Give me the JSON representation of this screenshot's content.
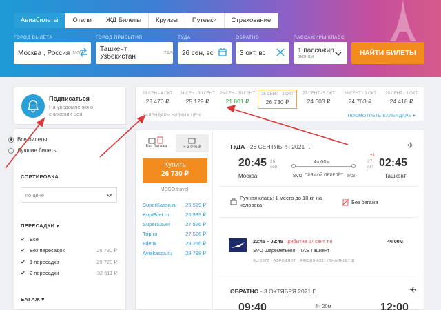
{
  "tabs": [
    "Авиабилеты",
    "Отели",
    "ЖД Билеты",
    "Круизы",
    "Путевки",
    "Страхование"
  ],
  "search": {
    "from_label": "ГОРОД ВЫЛЕТА",
    "from_value": "Москва , Россия",
    "from_code": "MOW",
    "to_label": "ГОРОД ПРИБЫТИЯ",
    "to_value": "Ташкент , Узбекистан",
    "to_code": "TAS",
    "date_label": "ТУДА",
    "date_value": "26 сен, вс",
    "return_label": "ОБРАТНО",
    "return_value": "3 окт, вс",
    "pax_label": "ПАССАЖИРЫ/КЛАСС",
    "pax_value": "1 пассажир",
    "class_value": "эконом",
    "search_button": "НАЙТИ БИЛЕТЫ"
  },
  "subscribe": {
    "title": "Подписаться",
    "text": "На уведомления о снижении цен"
  },
  "filters": {
    "options": [
      "Все билеты",
      "Лучшие билеты"
    ],
    "sort_heading": "СОРТИРОВКА",
    "sort_value": "по цене",
    "transfers_heading": "ПЕРЕСАДКИ ▾",
    "transfers": [
      {
        "label": "Все",
        "price": ""
      },
      {
        "label": "Без пересадок",
        "price": "26 730 ₽"
      },
      {
        "label": "1 пересадка",
        "price": "29 720 ₽"
      },
      {
        "label": "2 пересадки",
        "price": "32 611 ₽"
      }
    ],
    "baggage_heading": "БАГАЖ ▾"
  },
  "calendar": {
    "days": [
      {
        "dates": "23 СЕН - 4 ОКТ",
        "price": "23 470 ₽"
      },
      {
        "dates": "24 СЕН - 30 СЕНТ",
        "price": "25 129 ₽"
      },
      {
        "dates": "26 СЕН - 30 СЕНТ",
        "price": "21 801 ₽"
      },
      {
        "dates": "26 СЕНТ - 3 ОКТ",
        "price": "26 730 ₽"
      },
      {
        "dates": "27 СЕНТ - 5 ОКТ",
        "price": "24 603 ₽"
      },
      {
        "dates": "28 СЕНТ - 3 ОКТ",
        "price": "24 763 ₽"
      },
      {
        "dates": "29 СЕНТ - 3 ОКТ",
        "price": "24 418 ₽"
      }
    ],
    "heading": "КАЛЕНДАРЬ НИЗКИХ ЦЕН",
    "view_link": "ПОСМОТРЕТЬ КАЛЕНДАРЬ ▾"
  },
  "ticket": {
    "bag_none": "Без багажа",
    "bag_plus": "+ 3 046 ₽",
    "buy_label": "Купить",
    "buy_price": "26 730 ₽",
    "seller": "MEGO.travel",
    "agencies": [
      {
        "name": "SuperKassa.ru",
        "price": "26 929 ₽"
      },
      {
        "name": "KupiBilet.ru",
        "price": "26 939 ₽"
      },
      {
        "name": "SuperSaver",
        "price": "27 526 ₽"
      },
      {
        "name": "Trip.ru",
        "price": "27 526 ₽"
      },
      {
        "name": "Biletix",
        "price": "28 256 ₽"
      },
      {
        "name": "Aviakassa.ru",
        "price": "28 798 ₽"
      }
    ],
    "outbound": {
      "heading": "ТУДА",
      "date": "- 26 СЕНТЯБРЯ 2021 Г.",
      "dep_time": "20:45",
      "dep_day": "26 сен",
      "dep_city": "Москва",
      "duration": "4ч 00м",
      "route_label": "ПРЯМОЙ ПЕРЕЛЁТ",
      "from_code": "SVO",
      "to_code": "TAS",
      "arr_time": "02:45",
      "arr_day": "27 окт",
      "arr_plus": "+1",
      "arr_city": "Ташкент",
      "carry": "Ручная кладь: 1 место до 10 кг. на человека",
      "no_bag": "Без багажа",
      "seg_time": "20:45 – 02:45",
      "seg_arr": "Прибытие 27 сент. пн",
      "seg_route": "SVO Шереметьево—TAS Ташкент",
      "seg_dur": "4ч 00м",
      "seg_flight": "SU-1872 · АЭРОФЛОТ · AIRBUS A321 (SHARKLETS)"
    },
    "return": {
      "heading": "ОБРАТНО",
      "date": "- 3 ОКТЯБРЯ 2021 Г.",
      "dep_time": "09:40",
      "duration": "4ч 20м",
      "arr_time": "12:00"
    }
  },
  "colors": {
    "accent": "#2a9fd8",
    "orange": "#f28c1e",
    "arrow": "#d93a3a"
  }
}
